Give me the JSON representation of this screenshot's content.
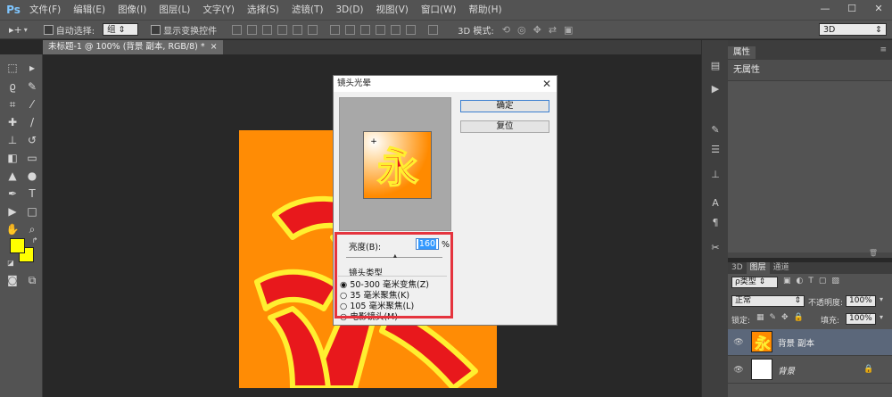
{
  "menubar": {
    "logo": "Ps",
    "items": [
      "文件(F)",
      "编辑(E)",
      "图像(I)",
      "图层(L)",
      "文字(Y)",
      "选择(S)",
      "滤镜(T)",
      "3D(D)",
      "视图(V)",
      "窗口(W)",
      "帮助(H)"
    ],
    "min": "—",
    "max": "☐",
    "close": "✕"
  },
  "optbar": {
    "auto_select_label": "自动选择:",
    "auto_select_value": "组",
    "show_transform_label": "显示变换控件",
    "mode_3d_label": "3D 模式:",
    "workspace": "3D"
  },
  "document_tab": {
    "title": "未标题-1 @ 100% (背景 副本, RGB/8) *",
    "close": "×"
  },
  "dialog": {
    "title": "镜头光晕",
    "ok_label": "确定",
    "reset_label": "复位",
    "brightness_label": "亮度(B):",
    "brightness_value": "160",
    "brightness_unit": "%",
    "brightness_percent": 160,
    "lens_type_label": "镜头类型",
    "lens_options": [
      "50-300 毫米变焦(Z)",
      "35 毫米聚焦(K)",
      "105 毫米聚焦(L)",
      "电影镜头(M)"
    ],
    "selected_lens": 0,
    "thumb_glyph": "永"
  },
  "properties": {
    "tab": "属性",
    "empty_text": "无属性"
  },
  "layers": {
    "tabs": [
      "3D",
      "图层",
      "通道"
    ],
    "filter_kind": "ρ类型",
    "blend_mode": "正常",
    "opacity_label": "不透明度:",
    "opacity_value": "100%",
    "lock_label": "锁定:",
    "fill_label": "填充:",
    "fill_value": "100%",
    "items": [
      {
        "name": "背景 副本",
        "glyph": "永"
      },
      {
        "name": "背景"
      }
    ]
  },
  "colors": {
    "foreground": "#ffff00",
    "background": "#ffff00",
    "canvas": "#ff8c05",
    "glyph_red": "#e8181c",
    "glyph_outline": "#ffef30",
    "highlight": "#e5343e"
  }
}
